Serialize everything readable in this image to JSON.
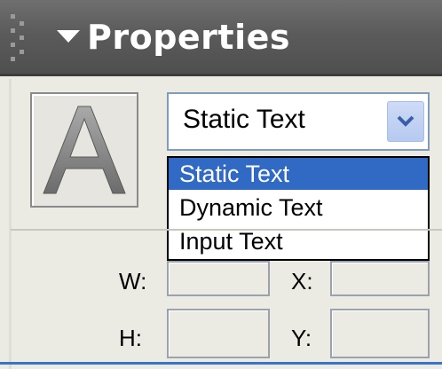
{
  "panel": {
    "title": "Properties",
    "colors": {
      "titlebar": "#5b5b5b",
      "selection": "#316ac5",
      "field_border": "#9aa3ad"
    }
  },
  "text_tool": {
    "icon": "text-tool-icon",
    "glyph": "A"
  },
  "text_type_select": {
    "selected_value": "Static Text",
    "options": [
      "Static Text",
      "Dynamic Text",
      "Input Text"
    ],
    "highlighted_index": 0
  },
  "fields": {
    "w": {
      "label": "W:",
      "value": ""
    },
    "h": {
      "label": "H:",
      "value": ""
    },
    "x": {
      "label": "X:",
      "value": ""
    },
    "y": {
      "label": "Y:",
      "value": ""
    }
  }
}
